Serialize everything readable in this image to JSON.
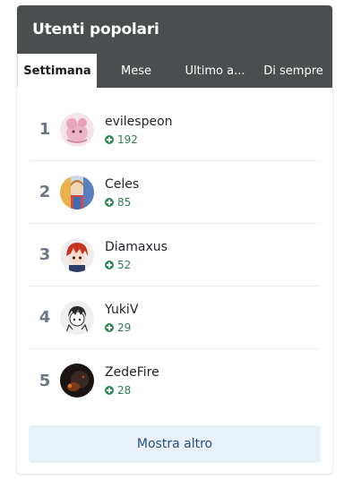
{
  "widget": {
    "title": "Utenti popolari",
    "tabs": [
      {
        "label": "Settimana",
        "active": true
      },
      {
        "label": "Mese",
        "active": false
      },
      {
        "label": "Ultimo a...",
        "active": false
      },
      {
        "label": "Di sempre",
        "active": false
      }
    ],
    "users": [
      {
        "rank": "1",
        "name": "evilespeon",
        "reputation": "192",
        "avatar_icon": "pink-creature-avatar"
      },
      {
        "rank": "2",
        "name": "Celes",
        "reputation": "85",
        "avatar_icon": "colorful-character-avatar"
      },
      {
        "rank": "3",
        "name": "Diamaxus",
        "reputation": "52",
        "avatar_icon": "red-hair-anime-avatar"
      },
      {
        "rank": "4",
        "name": "YukiV",
        "reputation": "29",
        "avatar_icon": "manga-sketch-avatar"
      },
      {
        "rank": "5",
        "name": "ZedeFire",
        "reputation": "28",
        "avatar_icon": "dark-fire-avatar"
      }
    ],
    "more_button": "Mostra altro"
  },
  "colors": {
    "header_bg": "#4a4e4f",
    "rep_green": "#2e8a57",
    "button_bg": "#e8f1fa",
    "button_text": "#254f80",
    "rank_gray": "#6b7687"
  }
}
